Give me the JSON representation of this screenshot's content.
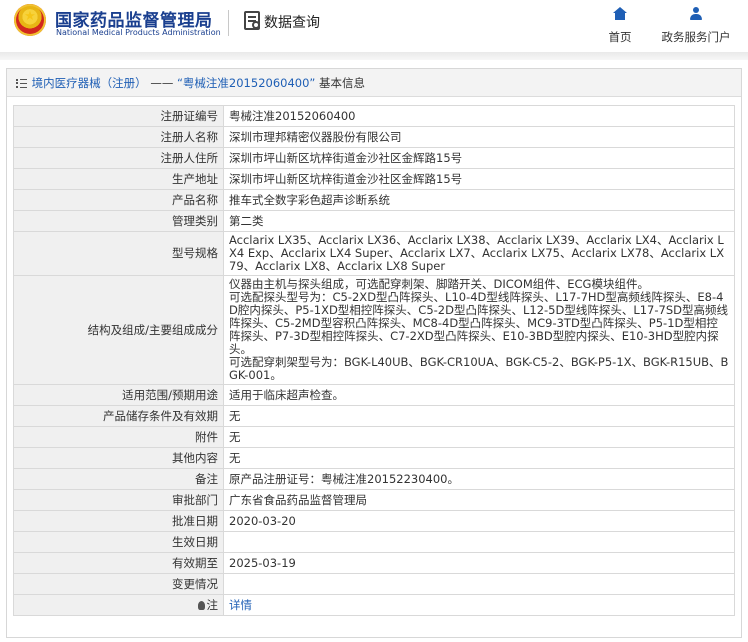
{
  "header": {
    "logo_cn": "国家药品监督管理局",
    "logo_en": "National Medical Products Administration",
    "query_label": "数据查询",
    "nav": [
      {
        "label": "首页",
        "icon": "home-icon"
      },
      {
        "label": "政务服务门户",
        "icon": "user-icon"
      }
    ]
  },
  "breadcrumb": {
    "category": "境内医疗器械（注册）",
    "separator": "——",
    "record": "“粤械注准20152060400”",
    "suffix": "基本信息"
  },
  "rows": [
    {
      "label": "注册证编号",
      "value": "粤械注准20152060400"
    },
    {
      "label": "注册人名称",
      "value": "深圳市理邦精密仪器股份有限公司"
    },
    {
      "label": "注册人住所",
      "value": "深圳市坪山新区坑梓街道金沙社区金辉路15号"
    },
    {
      "label": "生产地址",
      "value": "深圳市坪山新区坑梓街道金沙社区金辉路15号"
    },
    {
      "label": "产品名称",
      "value": "推车式全数字彩色超声诊断系统"
    },
    {
      "label": "管理类别",
      "value": "第二类"
    },
    {
      "label": "型号规格",
      "value": "Acclarix LX35、Acclarix LX36、Acclarix LX38、Acclarix LX39、Acclarix LX4、Acclarix LX4 Exp、Acclarix LX4 Super、Acclarix LX7、Acclarix LX75、Acclarix LX78、Acclarix LX79、Acclarix LX8、Acclarix LX8 Super"
    },
    {
      "label": "结构及组成/主要组成成分",
      "value": "仪器由主机与探头组成，可选配穿刺架、脚踏开关、DICOM组件、ECG模块组件。\n可选配探头型号为：C5-2XD型凸阵探头、L10-4D型线阵探头、L17-7HD型高频线阵探头、E8-4D腔内探头、P5-1XD型相控阵探头、C5-2D型凸阵探头、L12-5D型线阵探头、L17-7SD型高频线阵探头、C5-2MD型容积凸阵探头、MC8-4D型凸阵探头、MC9-3TD型凸阵探头、P5-1D型相控阵探头、P7-3D型相控阵探头、C7-2XD型凸阵探头、E10-3BD型腔内探头、E10-3HD型腔内探头。\n可选配穿刺架型号为：BGK-L40UB、BGK-CR10UA、BGK-C5-2、BGK-P5-1X、BGK-R15UB、BGK-001。"
    },
    {
      "label": "适用范围/预期用途",
      "value": "适用于临床超声检查。"
    },
    {
      "label": "产品储存条件及有效期",
      "value": "无"
    },
    {
      "label": "附件",
      "value": "无"
    },
    {
      "label": "其他内容",
      "value": "无"
    },
    {
      "label": "备注",
      "value": "原产品注册证号：粤械注准20152230400。"
    },
    {
      "label": "审批部门",
      "value": "广东省食品药品监督管理局"
    },
    {
      "label": "批准日期",
      "value": "2020-03-20"
    },
    {
      "label": "生效日期",
      "value": ""
    },
    {
      "label": "有效期至",
      "value": "2025-03-19"
    },
    {
      "label": "变更情况",
      "value": ""
    }
  ],
  "note": {
    "label": "注",
    "link": "详情"
  }
}
